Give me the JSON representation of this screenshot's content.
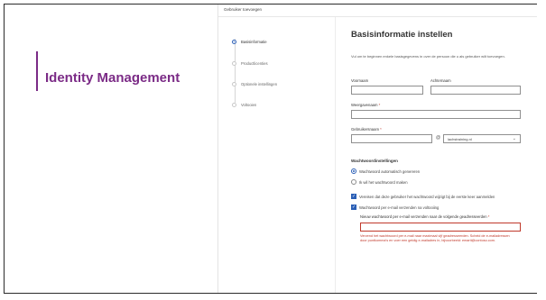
{
  "brand": {
    "title": "Identity Management",
    "accent": "#7b2b86"
  },
  "panel": {
    "title": "Gebruiker toevoegen"
  },
  "steps": [
    {
      "label": "Basisinformatie",
      "active": true
    },
    {
      "label": "Productlicenties",
      "active": false
    },
    {
      "label": "Optionele instellingen",
      "active": false
    },
    {
      "label": "Voltooien",
      "active": false
    }
  ],
  "form": {
    "heading": "Basisinformatie instellen",
    "description": "Vul om te beginnen enkele basisgegevens in over de persoon die u als gebruiker wilt toevoegen.",
    "first_name_label": "Voornaam",
    "first_name_value": "",
    "last_name_label": "Achternaam",
    "last_name_value": "",
    "display_name_label": "Weergavenaam",
    "display_name_value": "",
    "username_label": "Gebruikersnaam",
    "username_value": "",
    "at_symbol": "@",
    "domain_value": "lachstraining.nl",
    "required_mark": "*",
    "password_section": "Wachtwoordinstellingen",
    "radio_auto": "Wachtwoord automatisch genereren",
    "radio_manual": "Ik wil het wachtwoord maken",
    "checkbox_change": "Vereisen dat deze gebruiker het wachtwoord wijzigt bij de eerste keer aanmelden",
    "checkbox_email": "Wachtwoord per e-mail verzenden na voltooiing",
    "email_label": "Nieuw wachtwoord per e-mail verzenden naar de volgende geadresseerden",
    "email_value": "",
    "error_text": "Verzend het wachtwoord per e-mail naar maximaal vijf geadresseerden. Scheid de e-mailadressen door puntkomma's en voer een geldig e-mailadres in, bijvoorbeeld: emarti@contoso.com."
  },
  "colors": {
    "primary": "#2b5fb6",
    "error": "#c0392b"
  }
}
